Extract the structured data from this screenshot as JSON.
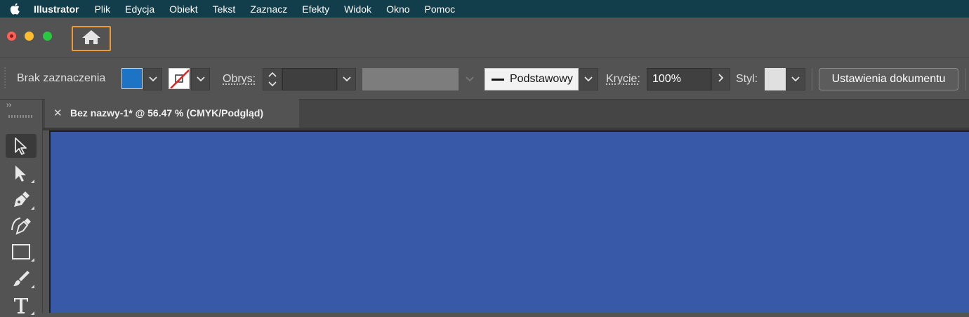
{
  "menubar": {
    "app_name": "Illustrator",
    "items": [
      "Plik",
      "Edycja",
      "Obiekt",
      "Tekst",
      "Zaznacz",
      "Efekty",
      "Widok",
      "Okno",
      "Pomoc"
    ],
    "background": "#123e4b"
  },
  "window": {
    "home_icon": "home-icon",
    "home_highlight_color": "#f09a37"
  },
  "control_bar": {
    "selection_status": "Brak zaznaczenia",
    "fill_color": "#1e74c4",
    "stroke_label": "Obrys:",
    "brush_label": "Podstawowy",
    "opacity_label": "Krycie:",
    "opacity_value": "100%",
    "style_label": "Styl:",
    "document_settings_button": "Ustawienia dokumentu"
  },
  "tabs": {
    "document_tab_title": "Bez nazwy-1* @ 56.47 % (CMYK/Podgląd)",
    "close_glyph": "✕"
  },
  "toolbar": {
    "collapse_glyph": "››",
    "tools": [
      "selection-tool-icon",
      "direct-selection-tool-icon",
      "pen-tool-icon",
      "curvature-tool-icon",
      "rectangle-tool-icon",
      "paintbrush-tool-icon",
      "type-tool-icon"
    ]
  },
  "artboard": {
    "color": "#3759a8"
  }
}
